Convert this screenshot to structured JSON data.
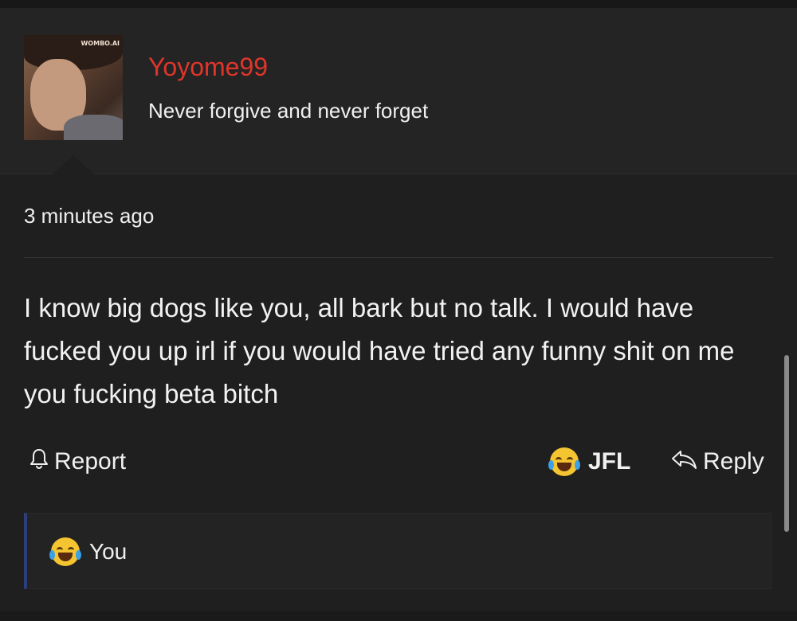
{
  "post": {
    "avatar_watermark": "WOMBO.AI",
    "username": "Yoyome99",
    "tagline": "Never forgive and never forget",
    "timestamp": "3 minutes ago",
    "body": "I know big dogs like you, all bark but no talk. I would have fucked you up irl if you would have tried any funny shit on me you fucking beta bitch"
  },
  "actions": {
    "report_label": "Report",
    "report_icon": "bell-icon",
    "jfl_label": "JFL",
    "jfl_icon": "crying-laughing-emoji",
    "reply_label": "Reply",
    "reply_icon": "reply-arrow-icon"
  },
  "reactions": {
    "icon": "crying-laughing-emoji",
    "label": "You"
  },
  "colors": {
    "background": "#1f1f1f",
    "header_background": "#242424",
    "username": "#e0352b",
    "reaction_accent": "#2c3f7a"
  }
}
